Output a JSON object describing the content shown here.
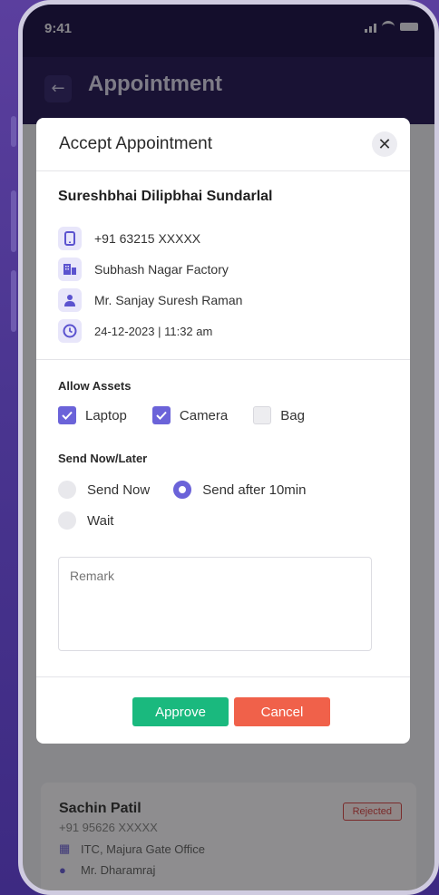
{
  "status_bar": {
    "time": "9:41"
  },
  "app_bar": {
    "title": "Appointment",
    "back_icon": "arrow-left-icon"
  },
  "background_card": {
    "name": "Sachin Patil",
    "phone": "+91 95626 XXXXX",
    "location": "ITC, Majura Gate Office",
    "host": "Mr. Dharamraj",
    "status": "Rejected"
  },
  "modal": {
    "title": "Accept Appointment",
    "close_icon": "close-icon",
    "visitor_name": "Sureshbhai Dilipbhai Sundarlal",
    "phone": "+91 63215 XXXXX",
    "location": "Subhash Nagar Factory",
    "host": "Mr. Sanjay Suresh Raman",
    "datetime": "24-12-2023 | 11:32 am",
    "allow_assets": {
      "label": "Allow Assets",
      "items": [
        {
          "label": "Laptop",
          "checked": true
        },
        {
          "label": "Camera",
          "checked": true
        },
        {
          "label": "Bag",
          "checked": false
        }
      ]
    },
    "send": {
      "label": "Send Now/Later",
      "options": [
        {
          "label": "Send Now",
          "selected": false
        },
        {
          "label": "Send after 10min",
          "selected": true
        },
        {
          "label": "Wait",
          "selected": false
        }
      ]
    },
    "remark": {
      "placeholder": "Remark",
      "value": ""
    },
    "approve_label": "Approve",
    "cancel_label": "Cancel"
  },
  "colors": {
    "accent": "#6b63d9",
    "approve": "#1ab97e",
    "cancel": "#f0614a",
    "rejected": "#d34a4a"
  }
}
